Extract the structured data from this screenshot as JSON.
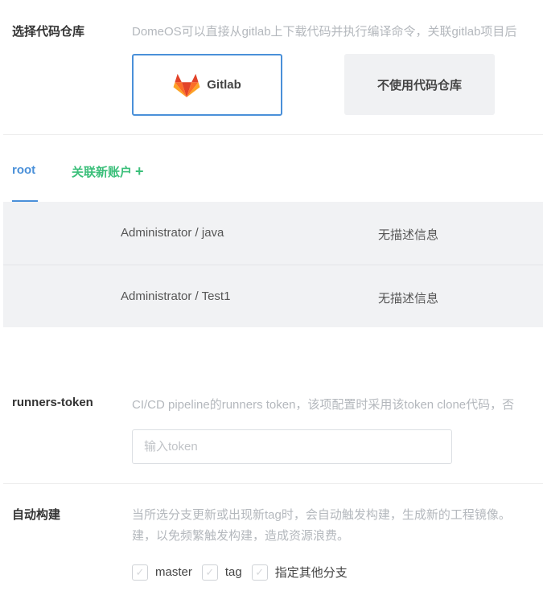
{
  "code_repo": {
    "label": "选择代码仓库",
    "description": "DomeOS可以直接从gitlab上下载代码并执行编译命令，关联gitlab项目后",
    "options": [
      {
        "label": "Gitlab",
        "icon": "gitlab-logo-icon",
        "selected": true
      },
      {
        "label": "不使用代码仓库",
        "selected": false
      }
    ]
  },
  "account_tabs": {
    "active": "root",
    "link_label": "关联新账户",
    "link_icon": "plus-icon"
  },
  "repositories": [
    {
      "name": "Administrator / java",
      "description": "无描述信息"
    },
    {
      "name": "Administrator / Test1",
      "description": "无描述信息"
    }
  ],
  "runners_token": {
    "label": "runners-token",
    "description": "CI/CD pipeline的runners token，该项配置时采用该token clone代码，否",
    "placeholder": "输入token",
    "value": ""
  },
  "auto_build": {
    "label": "自动构建",
    "description_line1": "当所选分支更新或出现新tag时，会自动触发构建，生成新的工程镜像。",
    "description_line2": "建，以免频繁触发构建，造成资源浪费。",
    "options": [
      {
        "label": "master",
        "checked": false
      },
      {
        "label": "tag",
        "checked": false
      },
      {
        "label": "指定其他分支",
        "checked": false
      }
    ]
  },
  "colors": {
    "accent_blue": "#4a90d9",
    "accent_green": "#3bbf7a",
    "table_bg": "#f1f2f4"
  }
}
